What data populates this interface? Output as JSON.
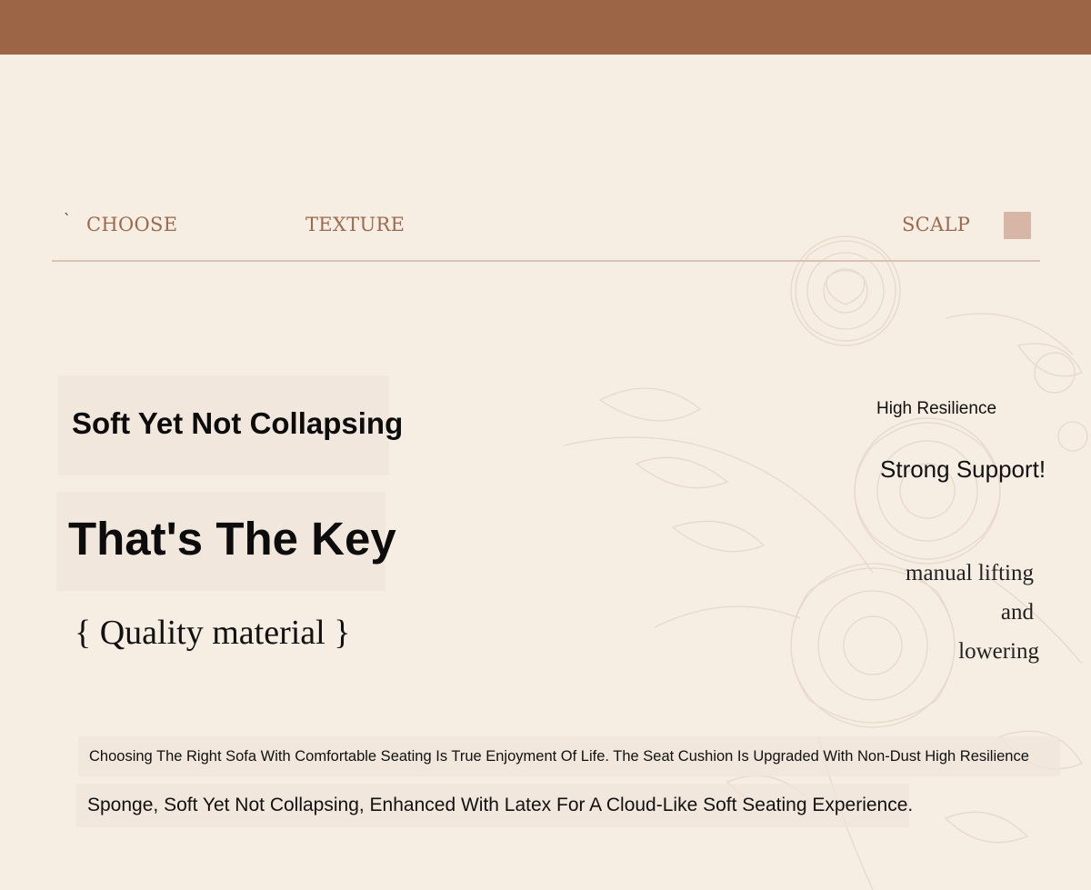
{
  "nav": {
    "tick": "`",
    "choose": "CHOOSE",
    "texture": "TEXTURE",
    "scalp": "SCALP"
  },
  "headline": {
    "line1": "Soft Yet Not Collapsing",
    "line2": "That's The Key",
    "tagline": "{ Quality material }"
  },
  "features": {
    "high_resilience": "High Resilience",
    "strong_support": "Strong Support!",
    "manual_1": "manual lifting",
    "manual_2": "and",
    "manual_3": "lowering"
  },
  "description": {
    "line1": "Choosing The Right Sofa With Comfortable Seating Is True Enjoyment Of Life. The Seat Cushion Is Upgraded With Non-Dust High Resilience",
    "line2": "Sponge, Soft Yet Not Collapsing, Enhanced With Latex For A Cloud-Like Soft Seating Experience."
  },
  "colors": {
    "header_bar": "#9c6646",
    "background": "#f6ede3",
    "nav_text": "#9c6a4c",
    "accent_square": "#d7b6a6"
  }
}
